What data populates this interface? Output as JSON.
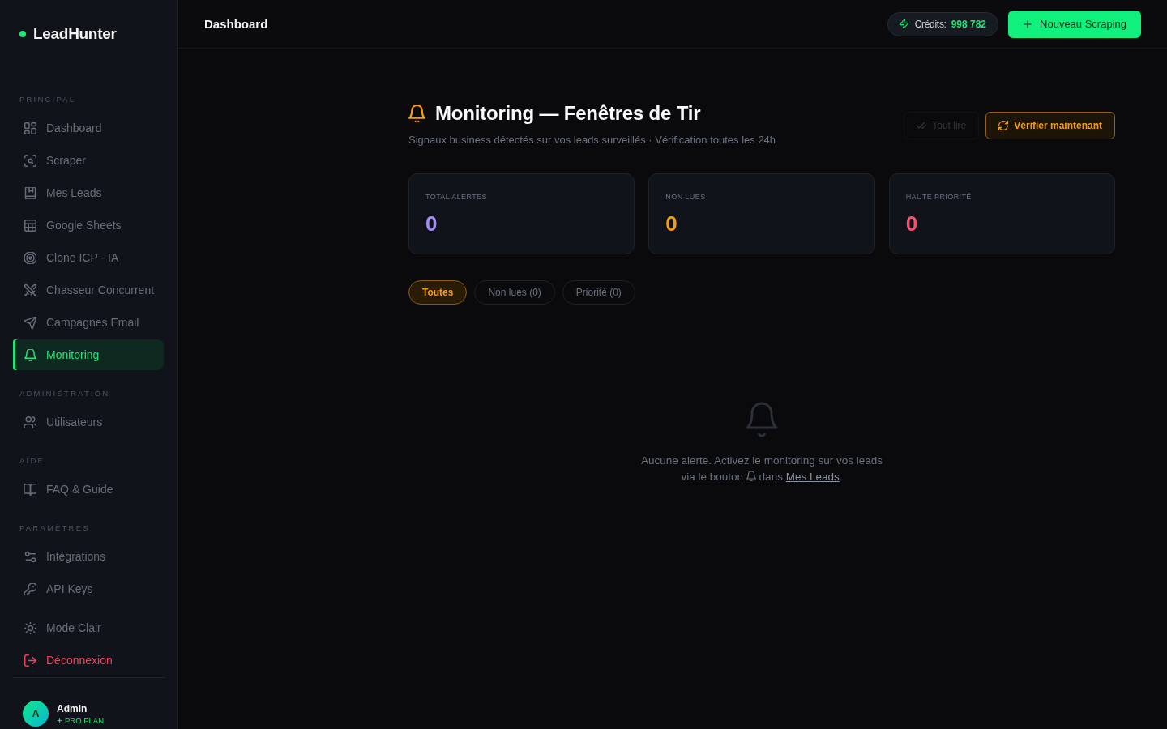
{
  "sidebar": {
    "logo": "LeadHunter",
    "sections": [
      {
        "title": "PRINCIPAL",
        "items": [
          {
            "label": "Dashboard",
            "selected": false
          },
          {
            "label": "Scraper",
            "selected": false
          },
          {
            "label": "Mes Leads",
            "selected": false
          },
          {
            "label": "Google Sheets",
            "selected": false
          },
          {
            "label": "Clone ICP - IA",
            "selected": false
          },
          {
            "label": "Chasseur Concurrent",
            "selected": false
          },
          {
            "label": "Campagnes Email",
            "selected": false
          },
          {
            "label": "Monitoring",
            "selected": true
          }
        ]
      },
      {
        "title": "ADMINISTRATION",
        "items": [
          {
            "label": "Utilisateurs",
            "selected": false
          }
        ]
      },
      {
        "title": "AIDE",
        "items": [
          {
            "label": "FAQ & Guide",
            "selected": false
          }
        ]
      },
      {
        "title": "PARAMÈTRES",
        "items": [
          {
            "label": "Intégrations",
            "selected": false
          },
          {
            "label": "API Keys",
            "selected": false
          }
        ]
      }
    ],
    "actions": [
      {
        "label": "Mode Clair",
        "kind": "toggle"
      },
      {
        "label": "Déconnexion",
        "kind": "logout"
      }
    ],
    "user": {
      "initial": "A",
      "name": "Admin",
      "plan": "PRO PLAN"
    }
  },
  "header": {
    "title": "Dashboard",
    "credits": {
      "label": "Crédits:",
      "value": "998 782"
    },
    "primary_button": "Nouveau Scraping"
  },
  "page": {
    "title": "Monitoring — Fenêtres de Tir",
    "subtitle": "Signaux business détectés sur vos leads surveillés · Vérification toutes les 24h",
    "buttons": [
      {
        "label": "Tout lire",
        "kind": "markread",
        "disabled": true
      },
      {
        "label": "Vérifier maintenant",
        "kind": "refresh",
        "disabled": false
      }
    ]
  },
  "stats": [
    {
      "label": "TOTAL ALERTES",
      "value": "0",
      "color": "#a78bfa"
    },
    {
      "label": "NON LUES",
      "value": "0",
      "color": "#f59e0b"
    },
    {
      "label": "HAUTE PRIORITÉ",
      "value": "0",
      "color": "#fb4f6e"
    }
  ],
  "filters": [
    {
      "label": "Toutes",
      "selected": true
    },
    {
      "label": "Non lues (0)",
      "selected": false
    },
    {
      "label": "Priorité (0)",
      "selected": false
    }
  ],
  "empty_state": {
    "line_1": "Aucune alerte. Activez le monitoring sur vos leads",
    "line_2_start": "via le bouton",
    "line_2_middle": "dans",
    "link": "Mes Leads",
    "line_2_end": "."
  }
}
